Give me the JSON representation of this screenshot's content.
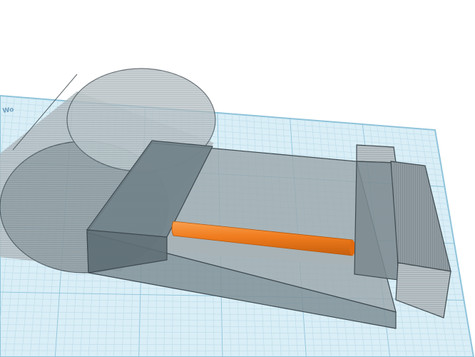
{
  "viewport": {
    "background": "#ffffff",
    "workplane_color": "#d9eef6",
    "grid_line_color": "#b7d8e8",
    "grid_major_color": "#8fc3da",
    "workplane_edge_color": "#8ec3d9"
  },
  "workplane": {
    "ruler_text": "Wo"
  },
  "objects": [
    {
      "name": "hole-cylinder",
      "kind": "hole",
      "color": "#9aa8ad"
    },
    {
      "name": "hole-base-block",
      "kind": "hole",
      "color": "#7f8f96"
    },
    {
      "name": "hole-left-wall",
      "kind": "hole",
      "color": "#6f7f86"
    },
    {
      "name": "hole-right-post",
      "kind": "hole",
      "color": "#6f7f86"
    },
    {
      "name": "hole-right-wall",
      "kind": "hole",
      "color": "#6f7f86"
    },
    {
      "name": "solid-rod",
      "kind": "solid",
      "color": "#f07c1e"
    }
  ]
}
